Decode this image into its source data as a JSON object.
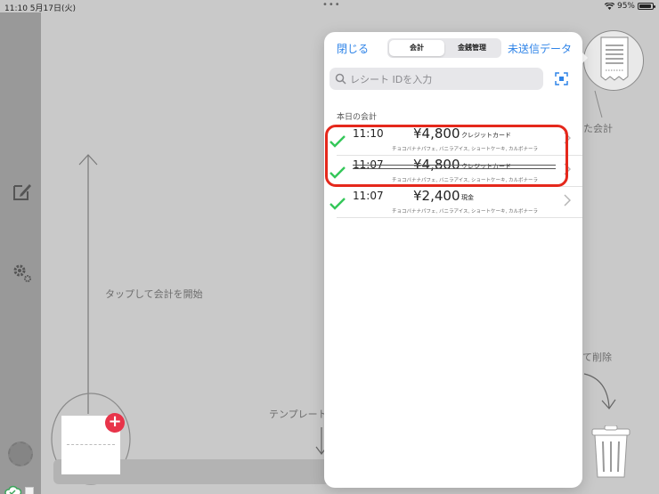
{
  "status_bar": {
    "time": "11:10 5月17日(火)",
    "dots": "•••",
    "battery": "95%",
    "battery_level": 0.95
  },
  "background": {
    "tap_hint": "タップして会計を開始",
    "template_hint": "テンプレート",
    "receipt_hint_fragment": "た会計",
    "delete_hint_fragment": "て削除"
  },
  "popover": {
    "close_label": "閉じる",
    "tabs": [
      {
        "label": "会計",
        "active": true
      },
      {
        "label": "金銭管理",
        "active": false
      }
    ],
    "unsent_label": "未送信データ",
    "search_placeholder": "レシート IDを入力",
    "section_title": "本日の会計",
    "transactions": [
      {
        "time": "11:10",
        "amount": "¥4,800",
        "method": "クレジットカード",
        "items": "チョコバナナパフェ, バニラアイス, ショートケーキ, カルボナーラ",
        "canceled": false
      },
      {
        "time": "11:07",
        "amount": "¥4,800",
        "method": "クレジットカード",
        "items": "チョコバナナパフェ, バニラアイス, ショートケーキ, カルボナーラ",
        "canceled": true
      },
      {
        "time": "11:07",
        "amount": "¥2,400",
        "method": "現金",
        "items": "チョコバナナパフェ, バニラアイス, ショートケーキ, カルボナーラ",
        "canceled": false
      }
    ]
  },
  "colors": {
    "accent": "#2f84e8",
    "check": "#34c759",
    "highlight": "#e5281c",
    "plus_badge": "#e8344a"
  }
}
